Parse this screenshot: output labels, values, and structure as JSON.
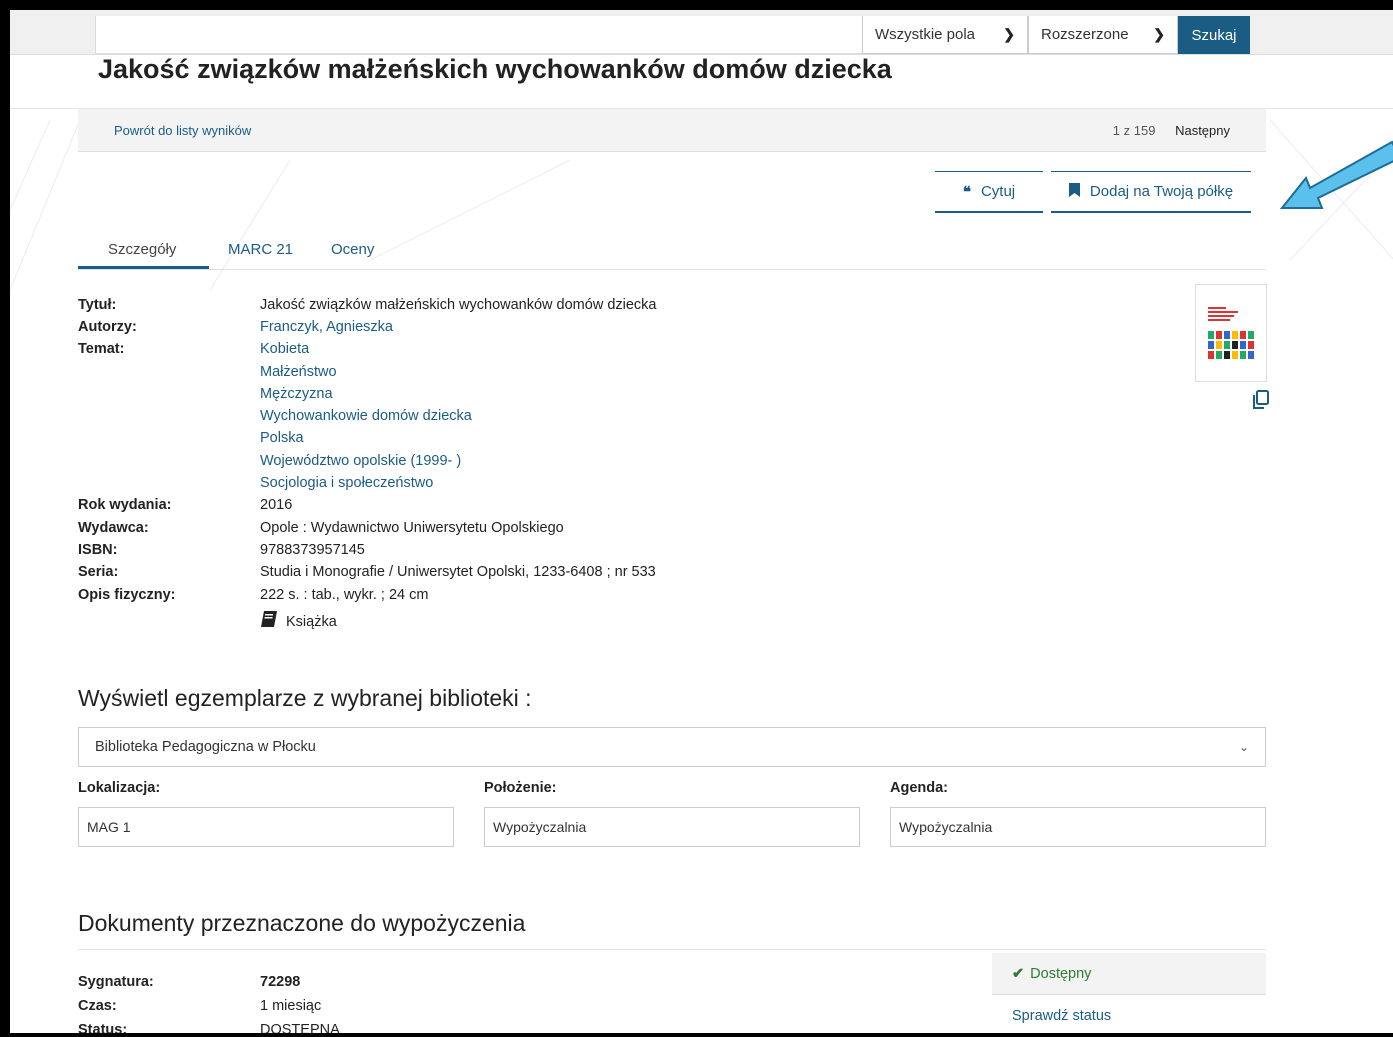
{
  "search": {
    "field_select": "Wszystkie pola",
    "mode_select": "Rozszerzone",
    "submit_label": "Szukaj"
  },
  "record": {
    "title": "Jakość związków małżeńskich wychowanków domów dziecka"
  },
  "nav": {
    "back_label": "Powrót do listy wyników",
    "position": "1 z 159",
    "next_label": "Następny"
  },
  "actions": {
    "cite_label": "Cytuj",
    "shelf_label": "Dodaj na Twoją półkę"
  },
  "tabs": [
    {
      "label": "Szczegóły"
    },
    {
      "label": "MARC 21"
    },
    {
      "label": "Oceny"
    }
  ],
  "details": {
    "title_label": "Tytuł:",
    "title_value": "Jakość związków małżeńskich wychowanków domów dziecka",
    "authors_label": "Autorzy:",
    "author": "Franczyk, Agnieszka",
    "subject_label": "Temat:",
    "subjects": [
      "Kobieta",
      "Małżeństwo",
      "Mężczyzna",
      "Wychowankowie domów dziecka",
      "Polska",
      "Województwo opolskie (1999- )",
      "Socjologia i społeczeństwo"
    ],
    "year_label": "Rok wydania:",
    "year_value": "2016",
    "publisher_label": "Wydawca:",
    "publisher_value": "Opole : Wydawnictwo Uniwersytetu Opolskiego",
    "isbn_label": "ISBN:",
    "isbn_value": "9788373957145",
    "series_label": "Seria:",
    "series_value": "Studia i Monografie / Uniwersytet Opolski, 1233-6408 ; nr 533",
    "physical_label": "Opis fizyczny:",
    "physical_value": "222 s. : tab., wykr. ; 24 cm",
    "type_label": "Książka"
  },
  "library": {
    "heading": "Wyświetl egzemplarze z wybranej biblioteki :",
    "selected": "Biblioteka Pedagogiczna w Płocku",
    "location_label": "Lokalizacja:",
    "location_value": "MAG 1",
    "placement_label": "Położenie:",
    "placement_value": "Wypożyczalnia",
    "agenda_label": "Agenda:",
    "agenda_value": "Wypożyczalnia"
  },
  "documents": {
    "heading": "Dokumenty przeznaczone do wypożyczenia",
    "signature_label": "Sygnatura:",
    "signature_value": "72298",
    "time_label": "Czas:",
    "time_value": "1 miesiąc",
    "status_label": "Status:",
    "status_value": "DOSTĘPNA",
    "availability": "Dostępny",
    "check_status": "Sprawdź status"
  },
  "colors": {
    "accent": "#1b5c84",
    "available": "#2e7d32",
    "annotation_arrow": "#5bc0eb"
  },
  "icons": [
    "quote-icon",
    "bookmark-icon",
    "copy-icon",
    "book-icon",
    "checkmark-icon",
    "chevron-down-icon"
  ]
}
